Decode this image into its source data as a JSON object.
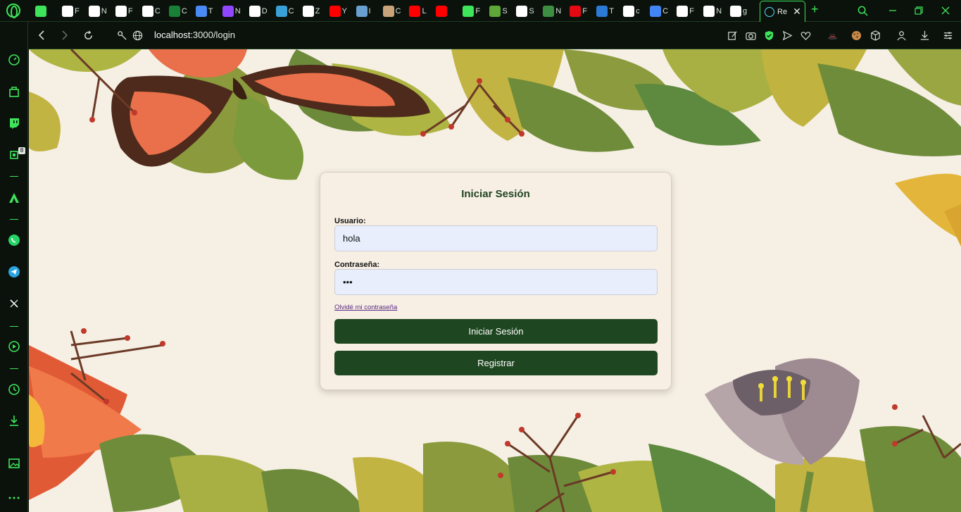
{
  "browser": {
    "tabs": [
      {
        "label": "",
        "icon": "gamepad-icon",
        "color": "#3ee45a"
      },
      {
        "label": "F",
        "icon": "globe-icon",
        "color": "#ffffff"
      },
      {
        "label": "N",
        "icon": "gear-icon",
        "color": "#ffffff"
      },
      {
        "label": "F",
        "icon": "github-icon",
        "color": "#ffffff"
      },
      {
        "label": "C",
        "icon": "chatgpt-icon",
        "color": "#ffffff"
      },
      {
        "label": "C",
        "icon": "chatgpt-icon",
        "color": "#1a7f37"
      },
      {
        "label": "T",
        "icon": "translate-icon",
        "color": "#4a8af4"
      },
      {
        "label": "N",
        "icon": "twitch-icon",
        "color": "#9146ff"
      },
      {
        "label": "D",
        "icon": "globe-icon",
        "color": "#ffffff"
      },
      {
        "label": "C",
        "icon": "e-icon",
        "color": "#3aa0d8"
      },
      {
        "label": "Z",
        "icon": "v-icon",
        "color": "#ffffff"
      },
      {
        "label": "Y",
        "icon": "youtube-icon",
        "color": "#ff0000"
      },
      {
        "label": "I",
        "icon": "image-icon",
        "color": "#6aa0d0"
      },
      {
        "label": "C",
        "icon": "avatar-icon",
        "color": "#c9a47a"
      },
      {
        "label": "L",
        "icon": "youtube-icon",
        "color": "#ff0000"
      },
      {
        "label": "",
        "icon": "youtube-icon",
        "color": "#ff0000"
      },
      {
        "label": "F",
        "icon": "diamond-icon",
        "color": "#3ee45a"
      },
      {
        "label": "S",
        "icon": "shopify-icon",
        "color": "#5ea83a"
      },
      {
        "label": "S",
        "icon": "n-icon",
        "color": "#ffffff"
      },
      {
        "label": "N",
        "icon": "node-icon",
        "color": "#3e8e41"
      },
      {
        "label": "F",
        "icon": "netflix-icon",
        "color": "#e50914"
      },
      {
        "label": "T",
        "icon": "terminal-icon",
        "color": "#2b7bd6"
      },
      {
        "label": "c",
        "icon": "google-icon",
        "color": "#ffffff"
      },
      {
        "label": "C",
        "icon": "lens-icon",
        "color": "#4285f4"
      },
      {
        "label": "F",
        "icon": "google-icon",
        "color": "#ffffff"
      },
      {
        "label": "N",
        "icon": "globe-icon",
        "color": "#ffffff"
      },
      {
        "label": "g",
        "icon": "google-icon",
        "color": "#ffffff"
      }
    ],
    "active_tab": {
      "label": "Re",
      "close": "✕"
    },
    "new_tab": "+",
    "url": {
      "host": "localhost",
      "path": ":3000/login"
    }
  },
  "login": {
    "title": "Iniciar Sesión",
    "user_label": "Usuario:",
    "user_value": "hola",
    "password_label": "Contraseña:",
    "password_value": "•••",
    "forgot": "Olvidé mi contraseña",
    "login_button": "Iniciar Sesión",
    "register_button": "Registrar"
  },
  "sidebar": {
    "twitch_badge": "8"
  },
  "colors": {
    "accent": "#3ee45a",
    "button": "#1e4620",
    "title": "#1f4421",
    "page_bg": "#f6efe4"
  }
}
